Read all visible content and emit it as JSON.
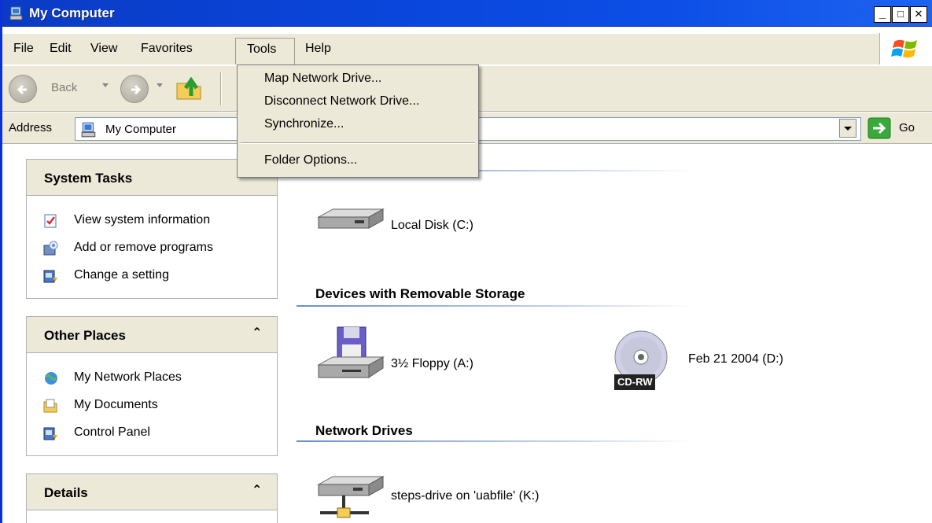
{
  "window": {
    "title": "My Computer"
  },
  "window_controls": {
    "minimize": "_",
    "maximize": "□",
    "close": "✕"
  },
  "menubar": {
    "items": [
      "File",
      "Edit",
      "View",
      "Favorites",
      "Tools",
      "Help"
    ]
  },
  "toolbar": {
    "back_label": "Back"
  },
  "addressbar": {
    "label": "Address",
    "value": "My Computer",
    "go_label": "Go"
  },
  "tools_menu": {
    "items": [
      "Map Network Drive...",
      "Disconnect Network Drive...",
      "Synchronize...",
      "Folder Options..."
    ]
  },
  "left_pane": {
    "system_tasks": {
      "title": "System Tasks",
      "items": [
        "View system information",
        "Add or remove programs",
        "Change a setting"
      ]
    },
    "other_places": {
      "title": "Other Places",
      "items": [
        "My Network Places",
        "My Documents",
        "Control Panel"
      ]
    },
    "details": {
      "title": "Details"
    },
    "collapse_glyph": "⌃"
  },
  "content": {
    "groups": [
      {
        "title": "Devices with Removable Storage"
      },
      {
        "title": "Network Drives"
      }
    ],
    "drives": {
      "local_c": "Local Disk (C:)",
      "floppy_a": "3½ Floppy (A:)",
      "cd_d": "Feb 21 2004 (D:)",
      "cd_badge": "CD-RW",
      "net_k": "steps-drive on 'uabfile' (K:)"
    }
  }
}
